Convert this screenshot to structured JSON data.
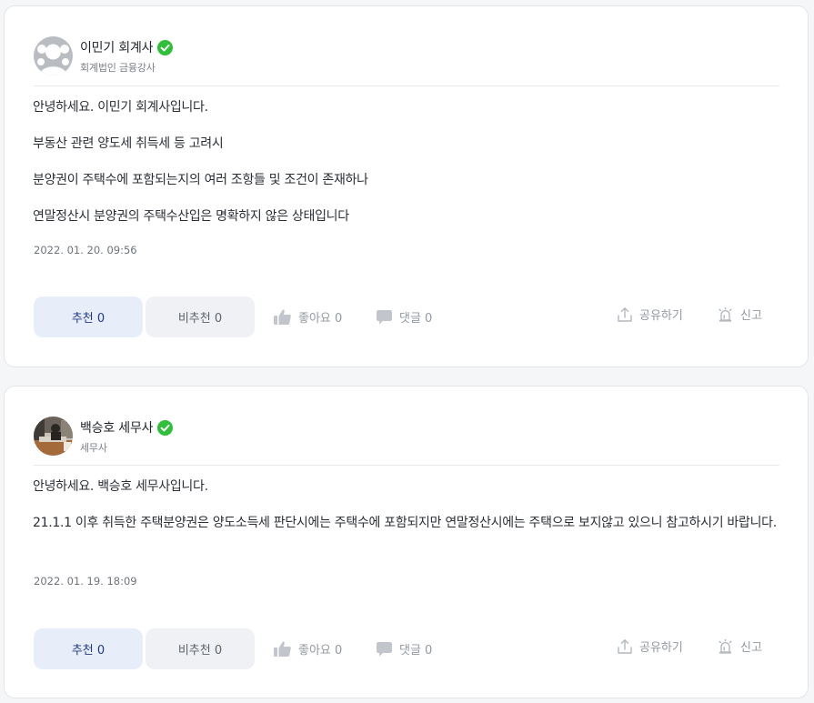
{
  "answers": [
    {
      "author": {
        "name": "이민기 회계사",
        "role": "회계법인 금융강사",
        "avatar": "default-avatar-icon",
        "verified": true
      },
      "paragraphs": [
        "안녕하세요. 이민기 회계사입니다.",
        "부동산 관련 양도세 취득세 등 고려시",
        "분양권이 주택수에 포함되는지의 여러 조항들 및 조건이 존재하나",
        "연말정산시 분양권의 주택수산입은 명확하지 않은 상태입니다"
      ],
      "date": "2022. 01. 20. 09:56",
      "actions": {
        "recommend": "추천 0",
        "unrecommend": "비추천 0",
        "like": "좋아요 0",
        "comment": "댓글 0",
        "share": "공유하기",
        "report": "신고"
      }
    },
    {
      "author": {
        "name": "백승호 세무사",
        "role": "세무사",
        "avatar": "profile-photo",
        "verified": true
      },
      "paragraphs": [
        "안녕하세요. 백승호 세무사입니다.",
        "21.1.1 이후 취득한 주택분양권은 양도소득세 판단시에는 주택수에 포함되지만 연말정산시에는 주택으로 보지않고 있으니 참고하시기 바랍니다."
      ],
      "date": "2022. 01. 19. 18:09",
      "actions": {
        "recommend": "추천 0",
        "unrecommend": "비추천 0",
        "like": "좋아요 0",
        "comment": "댓글 0",
        "share": "공유하기",
        "report": "신고"
      }
    }
  ],
  "colors": {
    "verified_badge": "#2fbf3a",
    "recommend_bg": "#e8eef9",
    "recommend_text": "#1f3a8a",
    "unrecommend_bg": "#eff1f4",
    "action_text": "#9399a1"
  }
}
